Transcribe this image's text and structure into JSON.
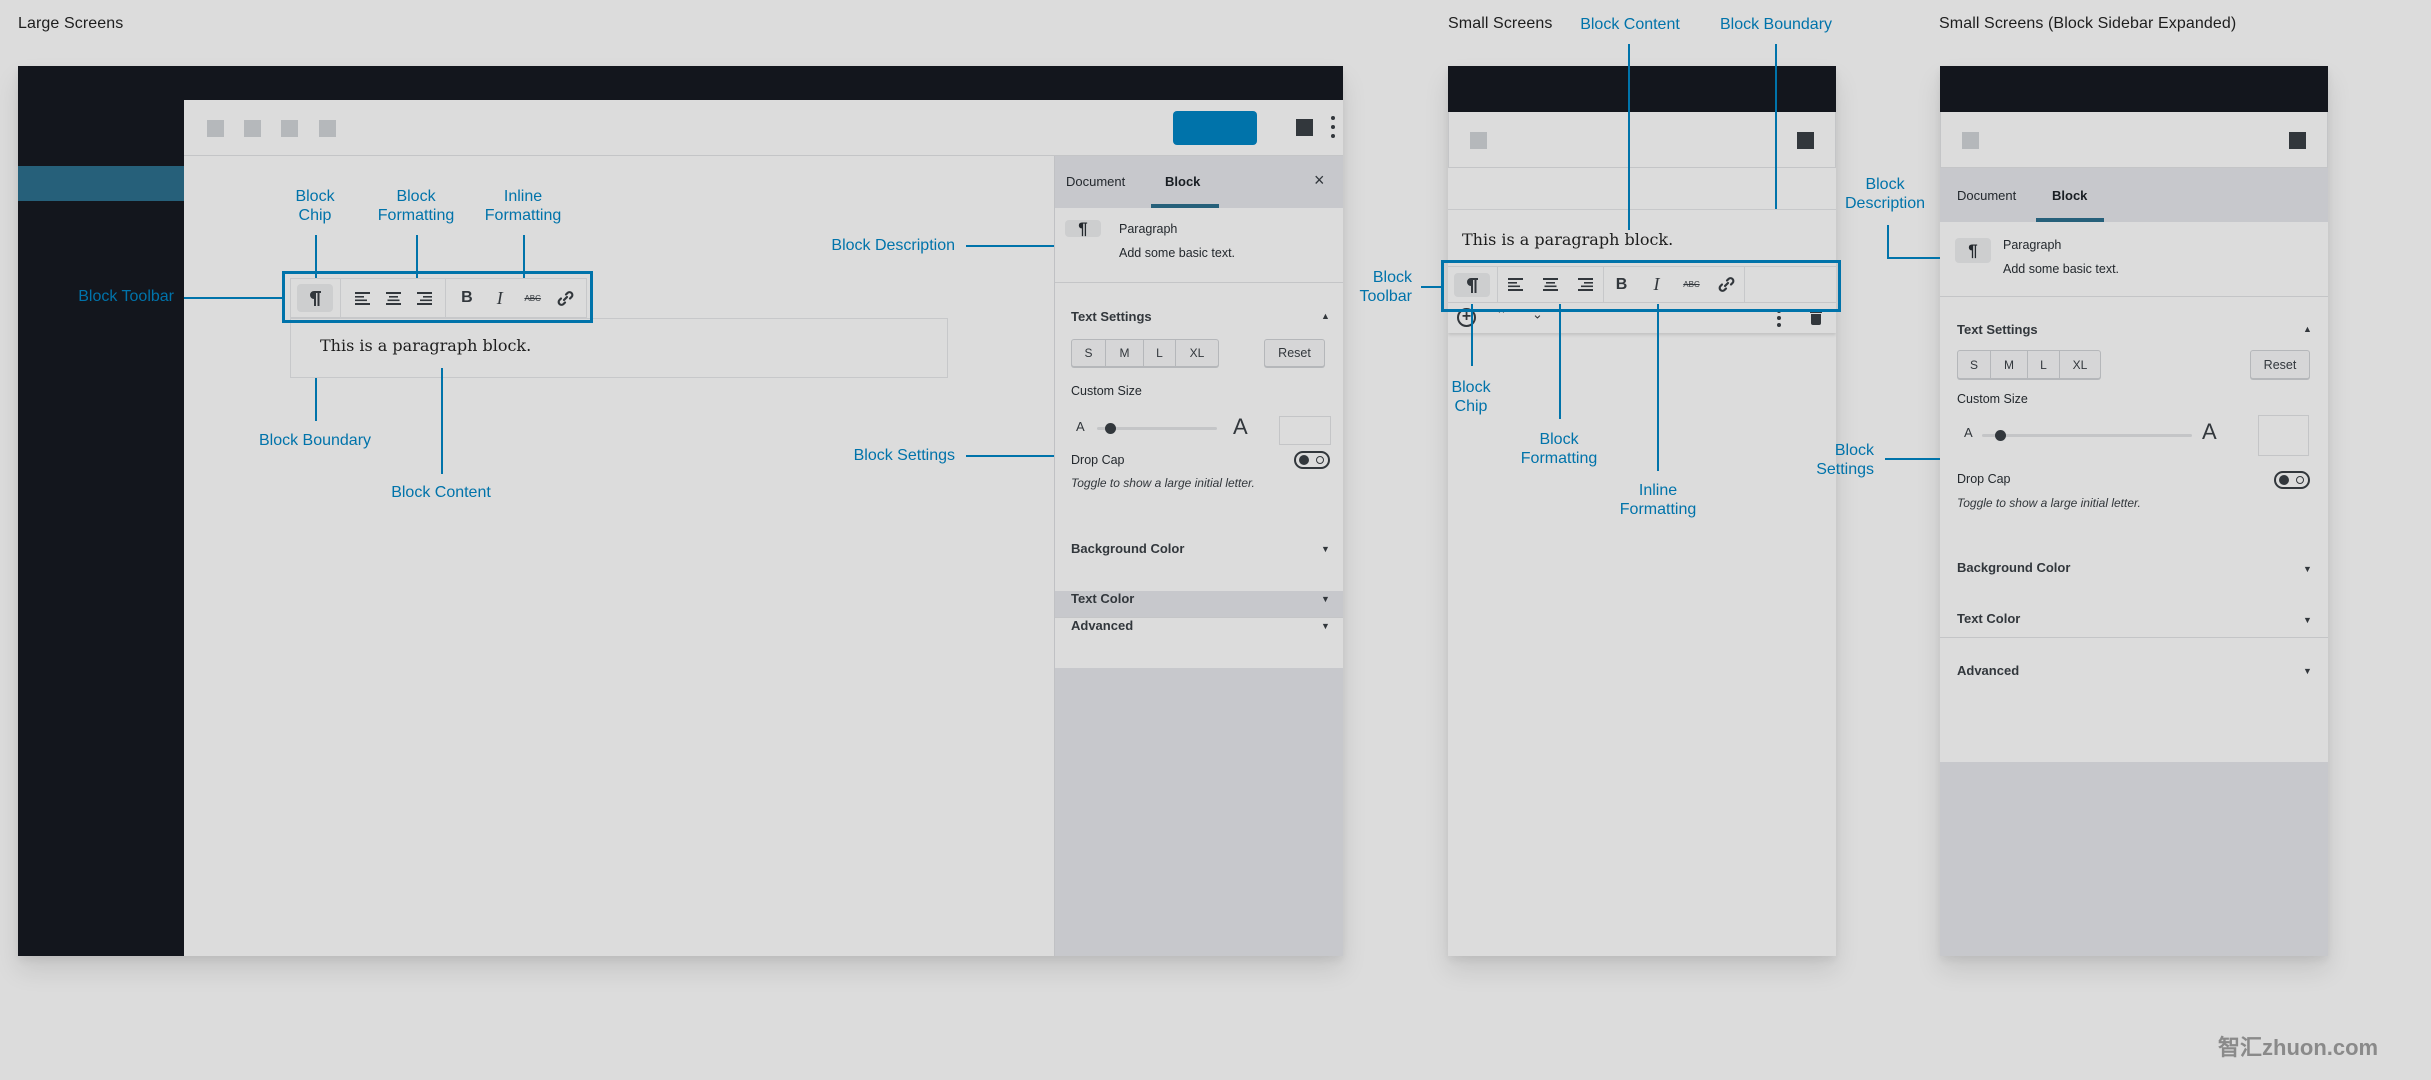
{
  "sections": {
    "large": "Large Screens",
    "small": "Small Screens",
    "small_expanded": "Small Screens (Block Sidebar Expanded)"
  },
  "annotations": {
    "block_chip": [
      "Block",
      "Chip"
    ],
    "block_formatting": [
      "Block",
      "Formatting"
    ],
    "inline_formatting": [
      "Inline",
      "Formatting"
    ],
    "block_toolbar": "Block Toolbar",
    "block_toolbar_split": [
      "Block",
      "Toolbar"
    ],
    "block_boundary": "Block Boundary",
    "block_content": "Block Content",
    "block_description": "Block Description",
    "block_description_split": [
      "Block",
      "Description"
    ],
    "block_settings": "Block Settings",
    "block_settings_split": [
      "Block",
      "Settings"
    ]
  },
  "editor": {
    "paragraph_text": "This is a paragraph block.",
    "toolbar_icons": {
      "chip": "paragraph-icon",
      "block_formatting": [
        "align-left-icon",
        "align-center-icon",
        "align-right-icon"
      ],
      "inline_formatting": [
        "bold-icon",
        "italic-icon",
        "strikethrough-icon",
        "link-icon"
      ]
    },
    "block_mover_icons": [
      "add-block-icon",
      "move-up-icon",
      "move-down-icon",
      "more-options-icon",
      "trash-icon"
    ]
  },
  "sidebar": {
    "tabs": [
      {
        "label": "Document",
        "active": false
      },
      {
        "label": "Block",
        "active": true
      }
    ],
    "close_icon": "close-icon",
    "block": {
      "icon": "¶",
      "name": "Paragraph",
      "description": "Add some basic text."
    },
    "text_settings": {
      "title": "Text Settings",
      "expanded": true,
      "sizes": [
        "S",
        "M",
        "L",
        "XL"
      ],
      "reset_label": "Reset",
      "custom_size_label": "Custom Size",
      "slider_small_label": "A",
      "slider_large_label": "A",
      "slider_value_fraction": 0.06,
      "custom_size_value": "",
      "drop_cap_label": "Drop Cap",
      "drop_cap_enabled": false,
      "drop_cap_help": "Toggle to show a large initial letter."
    },
    "panels": [
      {
        "title": "Background Color",
        "expanded": false
      },
      {
        "title": "Text Color",
        "expanded": false
      },
      {
        "title": "Advanced",
        "expanded": false
      }
    ]
  },
  "colors": {
    "annotation": "#0073aa",
    "dark_chrome": "#13161d",
    "teal_highlight": "#26607a",
    "publish_button": "#0073aa"
  },
  "watermark": "智汇zhuon.com"
}
